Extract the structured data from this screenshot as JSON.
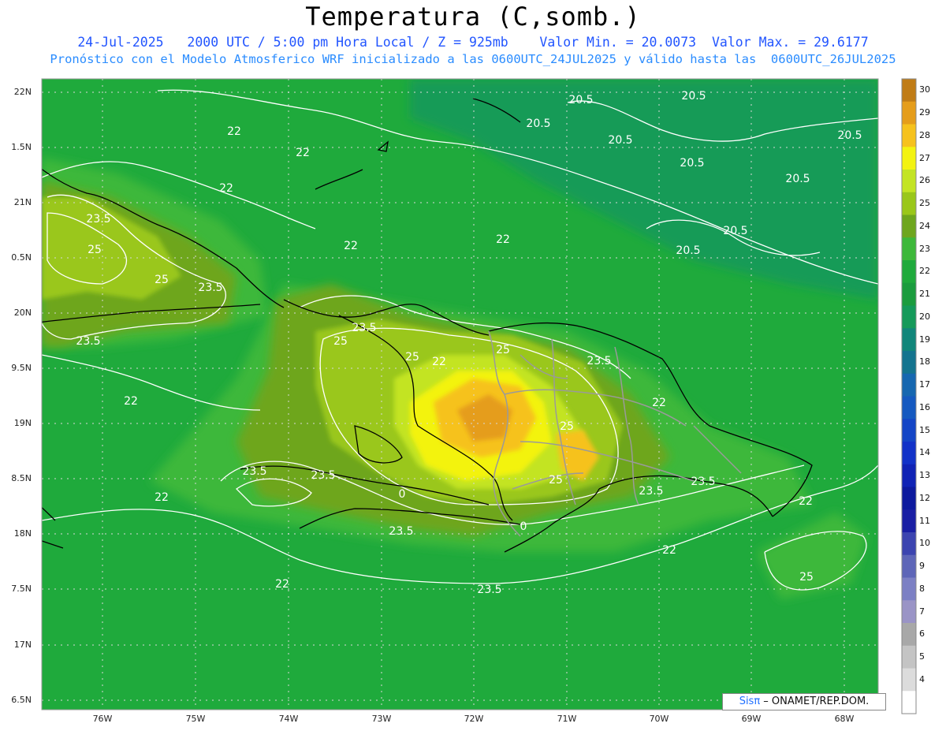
{
  "header": {
    "title": "Temperatura (C,somb.)",
    "line1": "24-Jul-2025   2000 UTC / 5:00 pm Hora Local / Z = 925mb    Valor Min. = 20.0073  Valor Max. = 29.6177",
    "line2": "Pronóstico con el Modelo Atmosferico WRF inicializado a las 0600UTC_24JUL2025 y válido hasta las  0600UTC_26JUL2025"
  },
  "map": {
    "lon_range": [
      -76.7,
      -67.6
    ],
    "lat_range": [
      16.4,
      22.1
    ],
    "lat_labels": [
      "22N",
      "1.5N",
      "21N",
      "0.5N",
      "20N",
      "9.5N",
      "19N",
      "8.5N",
      "18N",
      "7.5N",
      "17N",
      "6.5N"
    ],
    "lon_labels": [
      "76W",
      "75W",
      "74W",
      "73W",
      "72W",
      "71W",
      "70W",
      "69W",
      "68W"
    ],
    "contour_labels": [
      "20.5",
      "20.5",
      "20.5",
      "20.5",
      "20.5",
      "20.5",
      "20.5",
      "20.5",
      "20.5",
      "22",
      "22",
      "22",
      "22",
      "22",
      "22",
      "22",
      "22",
      "22",
      "22",
      "22",
      "22",
      "23.5",
      "23.5",
      "23.5",
      "23.5",
      "23.5",
      "23.5",
      "23.5",
      "23.5",
      "23.5",
      "23.5",
      "23.5",
      "25",
      "25",
      "25",
      "25",
      "25",
      "25",
      "25",
      "25",
      "0",
      "0"
    ],
    "colors": {
      "base": "#1faa3c",
      "c20": "#159a5a",
      "c23": "#3db83a",
      "c24": "#6ea61e",
      "c25": "#9ac71a",
      "c26": "#c3e424",
      "c27": "#f3f311",
      "c28": "#f6c21d",
      "c29": "#e59d1b",
      "c30": "#c07c16"
    }
  },
  "colorbar": {
    "labels": [
      "30",
      "29",
      "28",
      "27",
      "26",
      "25",
      "24",
      "23",
      "22",
      "21",
      "20",
      "19",
      "18",
      "17",
      "16",
      "15",
      "14",
      "13",
      "12",
      "11",
      "10",
      "9",
      "8",
      "7",
      "6",
      "5",
      "4"
    ],
    "colors": [
      "#c07c16",
      "#e59d1b",
      "#f6c21d",
      "#f3f311",
      "#c3e424",
      "#9ac71a",
      "#6ea61e",
      "#3db83a",
      "#1faa3c",
      "#1b9c3e",
      "#159a5a",
      "#11867a",
      "#14748f",
      "#1667b0",
      "#1559c0",
      "#1445c6",
      "#1232c8",
      "#1023b5",
      "#0d1a9e",
      "#1a1fa4",
      "#3c44b0",
      "#5e66b8",
      "#7c80c4",
      "#9a94c6",
      "#a8a8a8",
      "#c4c4c4",
      "#dcdcdc",
      "#ffffff"
    ]
  },
  "credit": {
    "sis": "Sisπ",
    "rest": " – ONAMET/REP.DOM."
  }
}
